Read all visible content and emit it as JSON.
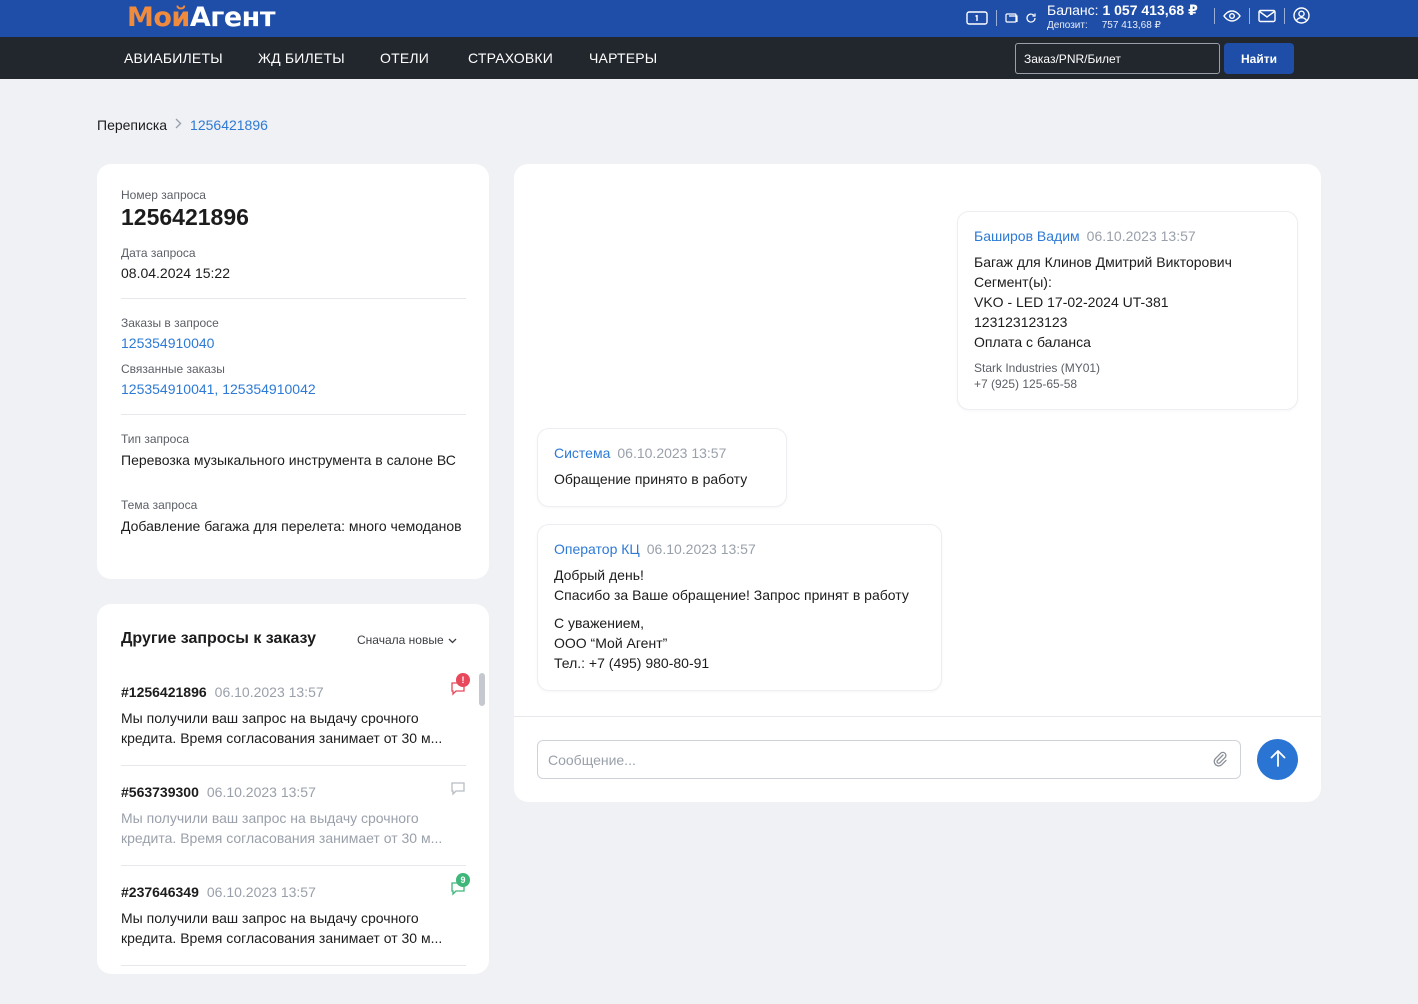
{
  "header": {
    "logo_part1": "Мой",
    "logo_part2": "Агент",
    "balance_label": "Баланс:",
    "balance_value": "1 057 413,68 ₽",
    "deposit_label": "Депозит:",
    "deposit_value": "757 413,68 ₽",
    "icons": [
      "wallet-icon",
      "card-icon",
      "refresh-icon",
      "eye-icon",
      "mail-icon",
      "user-icon"
    ]
  },
  "nav": {
    "items": [
      "АВИАБИЛЕТЫ",
      "ЖД БИЛЕТЫ",
      "ОТЕЛИ",
      "СТРАХОВКИ",
      "ЧАРТЕРЫ"
    ],
    "search_placeholder": "Заказ/PNR/Билет",
    "search_button": "Найти"
  },
  "breadcrumb": {
    "root": "Переписка",
    "current": "1256421896"
  },
  "request": {
    "number_label": "Номер запроса",
    "number": "1256421896",
    "date_label": "Дата запроса",
    "date": "08.04.2024 15:22",
    "orders_label": "Заказы в запросе",
    "orders": "125354910040",
    "related_label": "Связанные заказы",
    "related": "125354910041, 125354910042",
    "type_label": "Тип запроса",
    "type": "Перевозка музыкального инструмента в салоне ВС",
    "topic_label": "Тема запроса",
    "topic": "Добавление багажа для перелета: много чемоданов"
  },
  "other_requests": {
    "title": "Другие запросы к заказу",
    "sort_label": "Сначала новые",
    "items": [
      {
        "number": "#1256421896",
        "date": "06.10.2023 13:57",
        "line1": "Мы получили ваш запрос на выдачу срочного",
        "line2": "кредита. Время согласования занимает от 30 м...",
        "badge": "!"
      },
      {
        "number": "#563739300",
        "date": "06.10.2023 13:57",
        "line1": "Мы получили ваш запрос на выдачу срочного",
        "line2": "кредита. Время согласования занимает от 30 м...",
        "badge": ""
      },
      {
        "number": "#237646349",
        "date": "06.10.2023 13:57",
        "line1": "Мы получили ваш запрос на выдачу срочного",
        "line2": "кредита. Время согласования занимает от 30 м...",
        "badge": "9"
      }
    ],
    "colors": {
      "alert": "#e8485b",
      "count": "#3fb67a"
    }
  },
  "chat": {
    "messages": [
      {
        "author": "Баширов Вадим",
        "date": "06.10.2023 13:57",
        "lines": [
          "Багаж для Клинов Дмитрий Викторович",
          "Сегмент(ы):",
          "VKO - LED 17-02-2024 UT-381",
          "123123123123",
          "Оплата с баланса"
        ],
        "company": "Stark Industries (MY01)",
        "phone": "+7 (925) 125-65-58"
      },
      {
        "author": "Система",
        "date": "06.10.2023 13:57",
        "lines": [
          "Обращение принято в работу"
        ]
      },
      {
        "author": "Оператор КЦ",
        "date": "06.10.2023 13:57",
        "lines": [
          "Добрый день!",
          "Спасибо за Ваше обращение! Запрос принят в работу"
        ],
        "signature": [
          "С уважением,",
          "ООО “Мой Агент”",
          "Тел.: +7 (495) 980-80-91"
        ]
      }
    ],
    "input_placeholder": "Сообщение..."
  },
  "colors": {
    "brand": "#1f4ea8",
    "accent": "#2d7ad6",
    "logo_orange": "#f08a3c",
    "nav_bg": "#22262d"
  }
}
